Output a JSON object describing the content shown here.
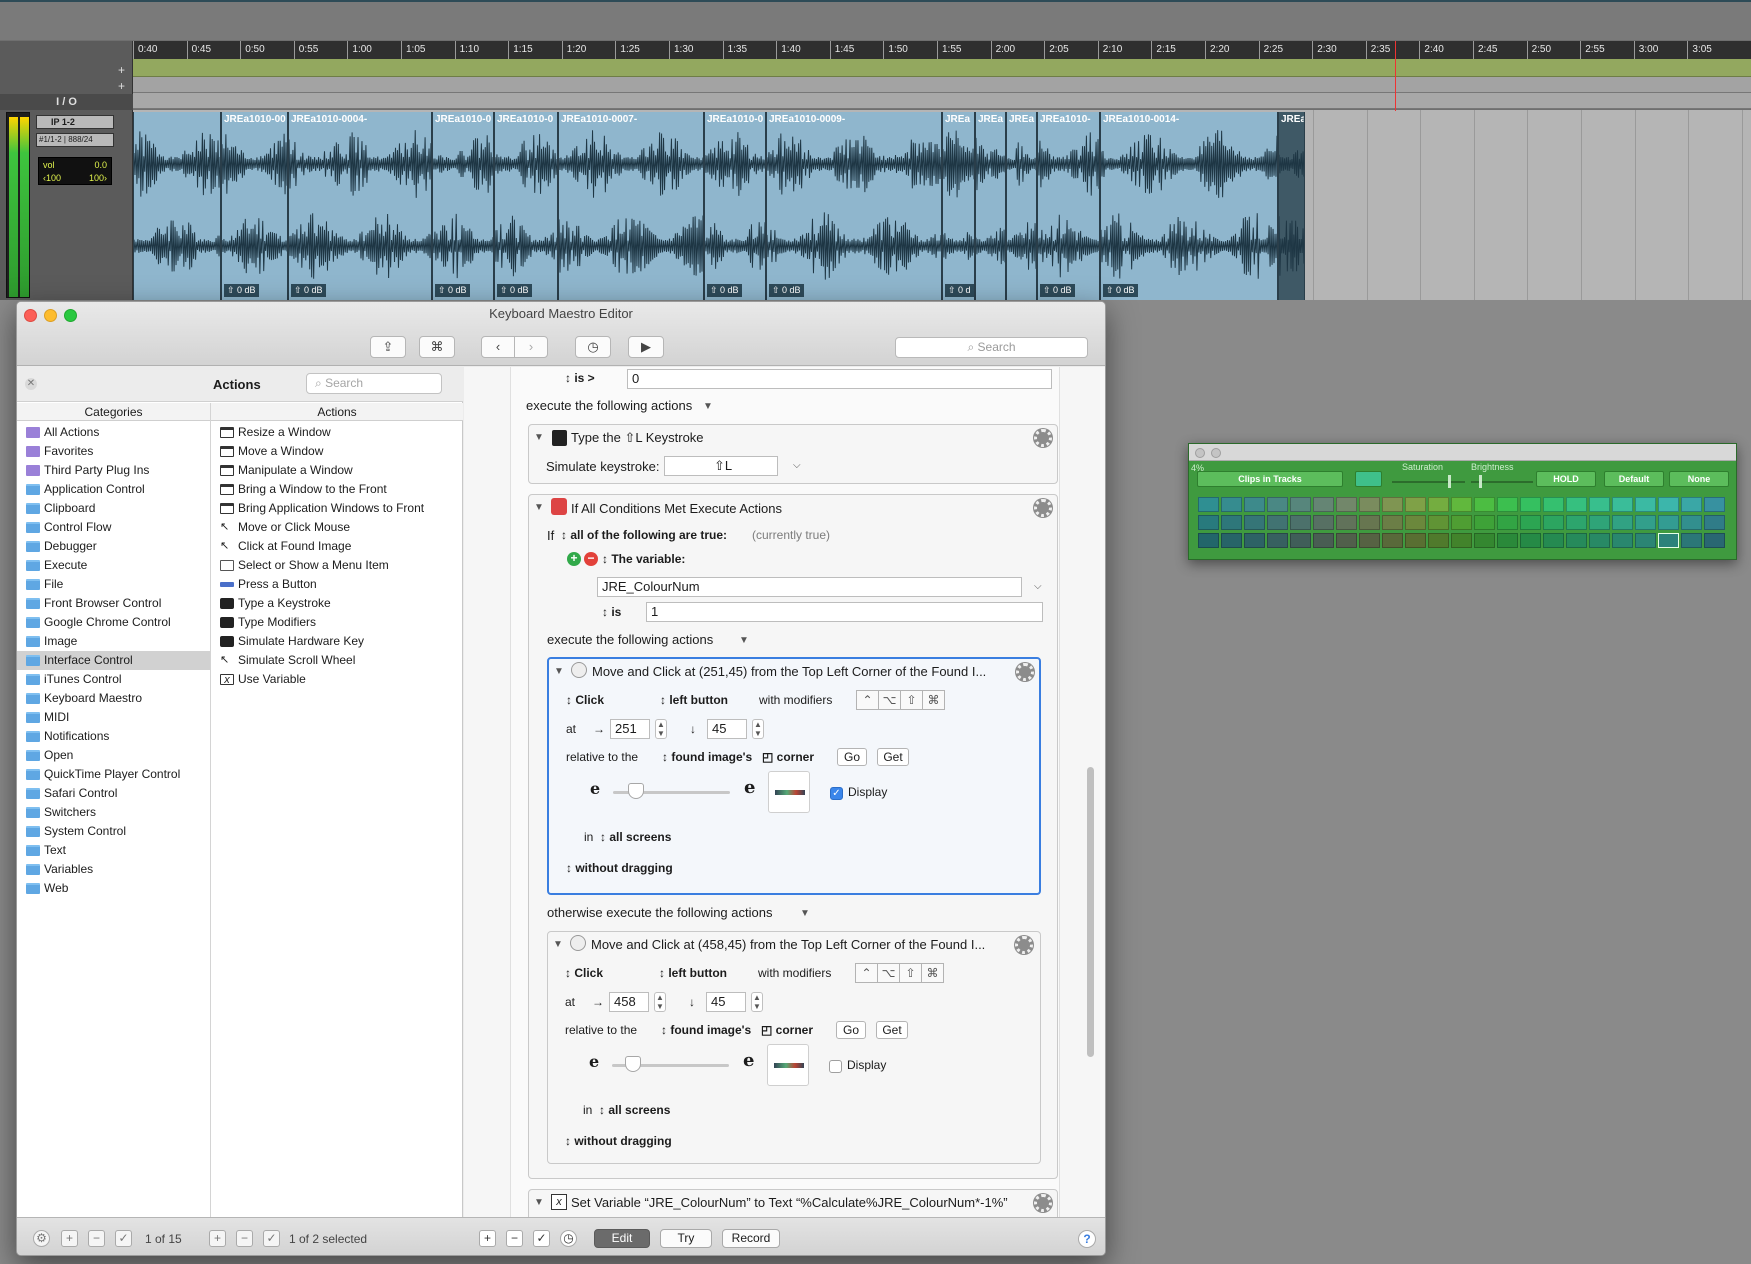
{
  "protools": {
    "ruler_ticks": [
      "0:40",
      "0:45",
      "0:50",
      "0:55",
      "1:00",
      "1:05",
      "1:10",
      "1:15",
      "1:20",
      "1:25",
      "1:30",
      "1:35",
      "1:40",
      "1:45",
      "1:50",
      "1:55",
      "2:00",
      "2:05",
      "2:10",
      "2:15",
      "2:20",
      "2:25",
      "2:30",
      "2:35",
      "2:40",
      "2:45",
      "2:50",
      "2:55",
      "3:00",
      "3:05"
    ],
    "io_header": "I / O",
    "io_input": "IP 1-2",
    "io_output": "#1/1-2 | 888/24",
    "vol_label": "vol",
    "vol_value": "0.0",
    "pan_left": "‹100",
    "pan_right": "100›",
    "clips": [
      {
        "name": "",
        "gain": ""
      },
      {
        "name": "JREa1010-00",
        "gain": "0 dB"
      },
      {
        "name": "JREa1010-0004-",
        "gain": "0 dB"
      },
      {
        "name": "JREa1010-0",
        "gain": "0 dB"
      },
      {
        "name": "JREa1010-0",
        "gain": "0 dB"
      },
      {
        "name": "JREa1010-0007-",
        "gain": ""
      },
      {
        "name": "JREa1010-0",
        "gain": "0 dB"
      },
      {
        "name": "JREa1010-0009-",
        "gain": "0 dB"
      },
      {
        "name": "JREa",
        "gain": "0 d"
      },
      {
        "name": "JREa",
        "gain": ""
      },
      {
        "name": "JREa",
        "gain": ""
      },
      {
        "name": "JREa1010-",
        "gain": "0 dB"
      },
      {
        "name": "JREa1010-0014-",
        "gain": "0 dB"
      },
      {
        "name": "JREa",
        "gain": ""
      }
    ]
  },
  "palette": {
    "dropdown": "Clips in Tracks",
    "saturation_label": "Saturation",
    "brightness_label": "Brightness",
    "hold": "HOLD",
    "default": "Default",
    "none": "None",
    "corner_text": "4%",
    "colors": {
      "row1": [
        "#2f8f92",
        "#368c8f",
        "#3d8a8b",
        "#4a8884",
        "#57867c",
        "#658574",
        "#72876a",
        "#7a8c5e",
        "#7f9552",
        "#7fa147",
        "#74ad40",
        "#61b83d",
        "#4cbd42",
        "#3cbf4f",
        "#35c060",
        "#35c06f",
        "#36c07f",
        "#38bf8d",
        "#3abd99",
        "#3bbaa3",
        "#3cb6ab",
        "#3aa7a6",
        "#3791a0"
      ],
      "row2": [
        "#287a7d",
        "#2e777a",
        "#357577",
        "#417372",
        "#4c716b",
        "#577063",
        "#61725a",
        "#677650",
        "#6b7e46",
        "#6b883c",
        "#609435",
        "#4f9e33",
        "#3ea238",
        "#32a444",
        "#2ca552",
        "#2ca560",
        "#2da56d",
        "#2fa478",
        "#31a283",
        "#329f8b",
        "#339c92",
        "#328f8e",
        "#307c88"
      ],
      "row3": [
        "#22666a",
        "#276468",
        "#2d6265",
        "#376060",
        "#405e59",
        "#495d53",
        "#515f4b",
        "#566243",
        "#59693a",
        "#596f32",
        "#507a2c",
        "#42832b",
        "#348730",
        "#2a893a",
        "#258a46",
        "#258a51",
        "#268a5b",
        "#288965",
        "#29876e",
        "#2b8574",
        "#2c827a",
        "#2b7777",
        "#296772"
      ]
    }
  },
  "km": {
    "window_title": "Keyboard Maestro Editor",
    "search_placeholder": "Search",
    "left": {
      "title": "Actions",
      "search_placeholder": "Search",
      "categories_header": "Categories",
      "actions_header": "Actions",
      "categories": [
        "All Actions",
        "Favorites",
        "Third Party Plug Ins",
        "Application Control",
        "Clipboard",
        "Control Flow",
        "Debugger",
        "Execute",
        "File",
        "Front Browser Control",
        "Google Chrome Control",
        "Image",
        "Interface Control",
        "iTunes Control",
        "Keyboard Maestro",
        "MIDI",
        "Notifications",
        "Open",
        "QuickTime Player Control",
        "Safari Control",
        "Switchers",
        "System Control",
        "Text",
        "Variables",
        "Web"
      ],
      "actions": [
        "Resize a Window",
        "Move a Window",
        "Manipulate a Window",
        "Bring a Window to the Front",
        "Bring Application Windows to Front",
        "Move or Click Mouse",
        "Click at Found Image",
        "Select or Show a Menu Item",
        "Press a Button",
        "Type a Keystroke",
        "Type Modifiers",
        "Simulate Hardware Key",
        "Simulate Scroll Wheel",
        "Use Variable"
      ]
    },
    "main": {
      "top_is": "is >",
      "top_is_value": "0",
      "execute_following": "execute the following actions",
      "type_title": "Type the ⇧L Keystroke",
      "simulate_label": "Simulate keystroke:",
      "simulate_value": "⇧L",
      "if_title": "If All Conditions Met Execute Actions",
      "if_label": "If",
      "all_following": "all of the following are true:",
      "currently": "(currently true)",
      "the_variable": "The variable:",
      "var_name": "JRE_ColourNum",
      "is_label": "is",
      "is_value": "1",
      "execute_following2": "execute the following actions",
      "move1": {
        "title": "Move and Click at (251,45) from the Top Left Corner of the Found I...",
        "click": "Click",
        "button": "left button",
        "with_modifiers": "with modifiers",
        "at": "at",
        "x": "251",
        "y": "45",
        "relative": "relative to the",
        "found": "found image's",
        "corner": "corner",
        "go": "Go",
        "get": "Get",
        "display": "Display",
        "in": "in",
        "screens": "all screens",
        "dragging": "without dragging"
      },
      "otherwise": "otherwise execute the following actions",
      "move2": {
        "title": "Move and Click at (458,45) from the Top Left Corner of the Found I...",
        "click": "Click",
        "button": "left button",
        "with_modifiers": "with modifiers",
        "at": "at",
        "x": "458",
        "y": "45",
        "relative": "relative to the",
        "found": "found image's",
        "corner": "corner",
        "go": "Go",
        "get": "Get",
        "display": "Display",
        "in": "in",
        "screens": "all screens",
        "dragging": "without dragging"
      },
      "setvar_title": "Set Variable “JRE_ColourNum” to Text “%Calculate%JRE_ColourNum*-1%”"
    },
    "bottom": {
      "left_count": "1 of 15",
      "mid_count": "1 of 2 selected",
      "edit": "Edit",
      "try": "Try",
      "record": "Record",
      "help": "?"
    },
    "modifier_glyphs": [
      "⌃",
      "⌥",
      "⇧",
      "⌘"
    ],
    "e_glyph": "e"
  }
}
